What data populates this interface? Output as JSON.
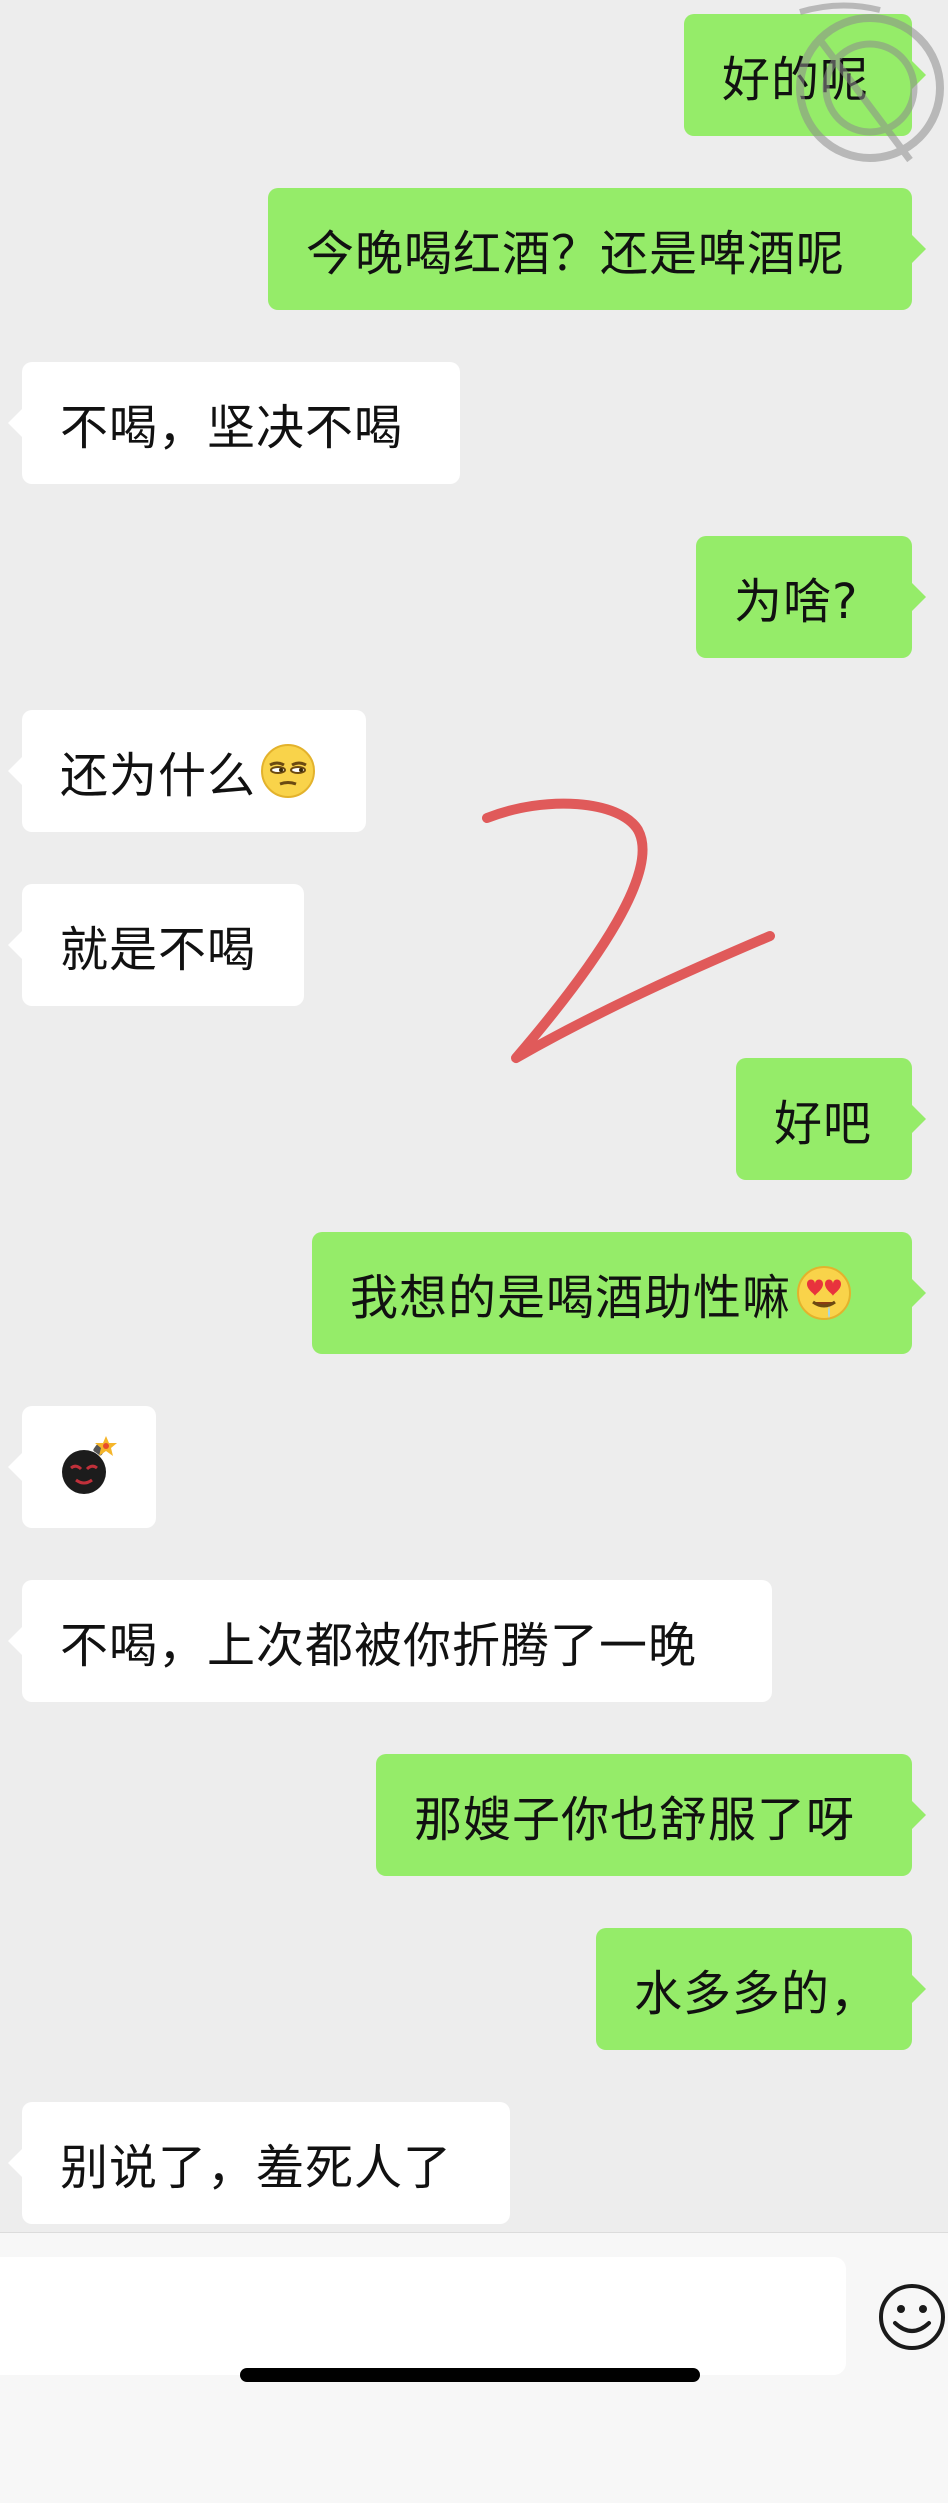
{
  "messages": [
    {
      "side": "outgoing",
      "text": "好的呢"
    },
    {
      "side": "outgoing",
      "text": "今晚喝红酒？还是啤酒呢"
    },
    {
      "side": "incoming",
      "text": "不喝，坚决不喝"
    },
    {
      "side": "outgoing",
      "text": "为啥?"
    },
    {
      "side": "incoming",
      "text": "还为什么",
      "emoji": "unamused-face-emoji"
    },
    {
      "side": "incoming",
      "text": "就是不喝"
    },
    {
      "side": "outgoing",
      "text": "好吧"
    },
    {
      "side": "outgoing",
      "text": "我想的是喝酒助性嘛",
      "emoji": "drooling-heart-eyes-emoji"
    },
    {
      "side": "incoming",
      "text": "",
      "emoji": "bomb-emoji"
    },
    {
      "side": "incoming",
      "text": "不喝，上次都被你折腾了一晚"
    },
    {
      "side": "outgoing",
      "text": "那嫂子你也舒服了呀"
    },
    {
      "side": "outgoing",
      "text": "水多多的，"
    },
    {
      "side": "incoming",
      "text": "别说了，羞死人了"
    }
  ],
  "input": {
    "value": "",
    "emoji_button_icon": "smiley-face-icon"
  },
  "colors": {
    "background": "#ededed",
    "outgoing_bubble": "#95ec69",
    "incoming_bubble": "#ffffff",
    "annotation_stroke": "#e05a5a"
  }
}
